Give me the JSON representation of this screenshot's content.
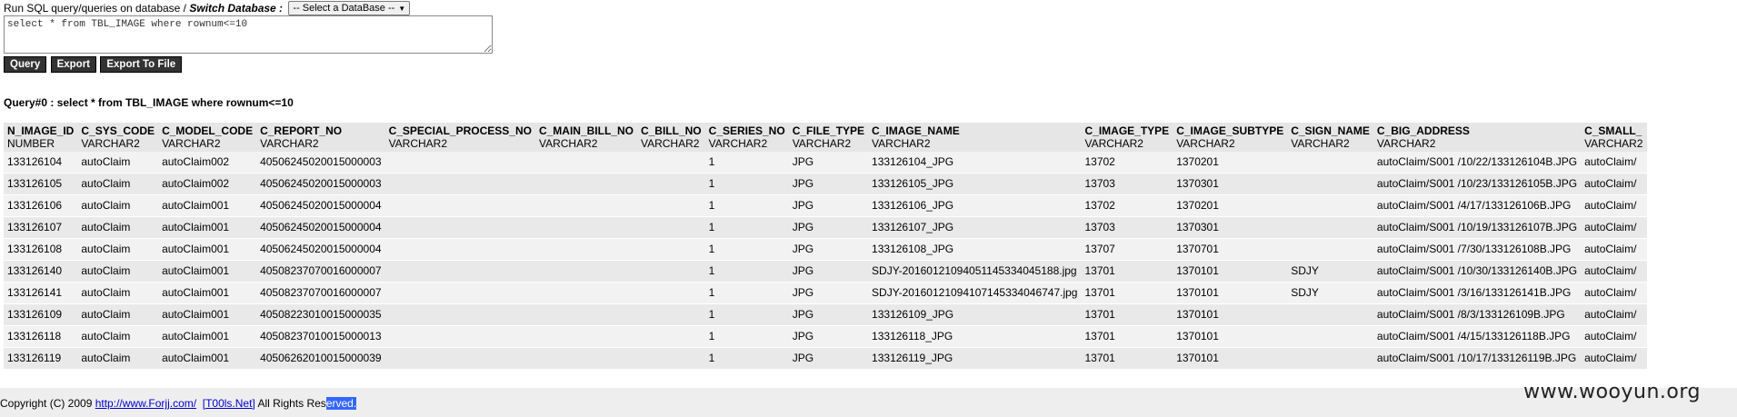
{
  "header": {
    "run_label": "Run SQL query/queries on database / ",
    "switch_label": "Switch Database :",
    "db_select_value": "-- Select a DataBase --",
    "sql_text": "select * from TBL_IMAGE where rownum<=10"
  },
  "buttons": {
    "query": "Query",
    "export": "Export",
    "export_file": "Export To File"
  },
  "result_caption": "Query#0 : select * from TBL_IMAGE where rownum<=10",
  "table": {
    "columns": [
      {
        "name": "N_IMAGE_ID",
        "type": "NUMBER"
      },
      {
        "name": "C_SYS_CODE",
        "type": "VARCHAR2"
      },
      {
        "name": "C_MODEL_CODE",
        "type": "VARCHAR2"
      },
      {
        "name": "C_REPORT_NO",
        "type": "VARCHAR2"
      },
      {
        "name": "C_SPECIAL_PROCESS_NO",
        "type": "VARCHAR2"
      },
      {
        "name": "C_MAIN_BILL_NO",
        "type": "VARCHAR2"
      },
      {
        "name": "C_BILL_NO",
        "type": "VARCHAR2"
      },
      {
        "name": "C_SERIES_NO",
        "type": "VARCHAR2"
      },
      {
        "name": "C_FILE_TYPE",
        "type": "VARCHAR2"
      },
      {
        "name": "C_IMAGE_NAME",
        "type": "VARCHAR2"
      },
      {
        "name": "C_IMAGE_TYPE",
        "type": "VARCHAR2"
      },
      {
        "name": "C_IMAGE_SUBTYPE",
        "type": "VARCHAR2"
      },
      {
        "name": "C_SIGN_NAME",
        "type": "VARCHAR2"
      },
      {
        "name": "C_BIG_ADDRESS",
        "type": "VARCHAR2"
      },
      {
        "name": "C_SMALL_",
        "type": "VARCHAR2"
      }
    ],
    "rows": [
      [
        "133126104",
        "autoClaim",
        "autoClaim002",
        "40506245020015000003",
        "",
        "",
        "",
        "1",
        "JPG",
        "133126104_JPG",
        "13702",
        "1370201",
        "",
        "autoClaim/S001 /10/22/133126104B.JPG",
        "autoClaim/"
      ],
      [
        "133126105",
        "autoClaim",
        "autoClaim002",
        "40506245020015000003",
        "",
        "",
        "",
        "1",
        "JPG",
        "133126105_JPG",
        "13703",
        "1370301",
        "",
        "autoClaim/S001 /10/23/133126105B.JPG",
        "autoClaim/"
      ],
      [
        "133126106",
        "autoClaim",
        "autoClaim001",
        "40506245020015000004",
        "",
        "",
        "",
        "1",
        "JPG",
        "133126106_JPG",
        "13702",
        "1370201",
        "",
        "autoClaim/S001 /4/17/133126106B.JPG",
        "autoClaim/"
      ],
      [
        "133126107",
        "autoClaim",
        "autoClaim001",
        "40506245020015000004",
        "",
        "",
        "",
        "1",
        "JPG",
        "133126107_JPG",
        "13703",
        "1370301",
        "",
        "autoClaim/S001 /10/19/133126107B.JPG",
        "autoClaim/"
      ],
      [
        "133126108",
        "autoClaim",
        "autoClaim001",
        "40506245020015000004",
        "",
        "",
        "",
        "1",
        "JPG",
        "133126108_JPG",
        "13707",
        "1370701",
        "",
        "autoClaim/S001 /7/30/133126108B.JPG",
        "autoClaim/"
      ],
      [
        "133126140",
        "autoClaim",
        "autoClaim001",
        "40508237070016000007",
        "",
        "",
        "",
        "1",
        "JPG",
        "SDJY-20160121094051145334045188.jpg",
        "13701",
        "1370101",
        "SDJY",
        "autoClaim/S001 /10/30/133126140B.JPG",
        "autoClaim/"
      ],
      [
        "133126141",
        "autoClaim",
        "autoClaim001",
        "40508237070016000007",
        "",
        "",
        "",
        "1",
        "JPG",
        "SDJY-20160121094107145334046747.jpg",
        "13701",
        "1370101",
        "SDJY",
        "autoClaim/S001 /3/16/133126141B.JPG",
        "autoClaim/"
      ],
      [
        "133126109",
        "autoClaim",
        "autoClaim001",
        "40508223010015000035",
        "",
        "",
        "",
        "1",
        "JPG",
        "133126109_JPG",
        "13701",
        "1370101",
        "",
        "autoClaim/S001 /8/3/133126109B.JPG",
        "autoClaim/"
      ],
      [
        "133126118",
        "autoClaim",
        "autoClaim001",
        "40508237010015000013",
        "",
        "",
        "",
        "1",
        "JPG",
        "133126118_JPG",
        "13701",
        "1370101",
        "",
        "autoClaim/S001 /4/15/133126118B.JPG",
        "autoClaim/"
      ],
      [
        "133126119",
        "autoClaim",
        "autoClaim001",
        "40506262010015000039",
        "",
        "",
        "",
        "1",
        "JPG",
        "133126119_JPG",
        "13701",
        "1370101",
        "",
        "autoClaim/S001 /10/17/133126119B.JPG",
        "autoClaim/"
      ]
    ]
  },
  "footer": {
    "copyright": "Copyright (C) 2009 ",
    "link1": "http://www.Forjj.com/",
    "link2": "[T00ls.Net]",
    "rights_a": " All Rights Res",
    "rights_b": "erved."
  },
  "watermark": "www.wooyun.org"
}
